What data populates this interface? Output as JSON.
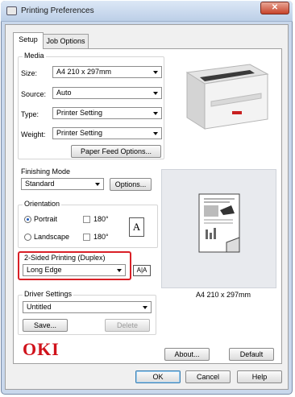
{
  "window": {
    "title": "Printing Preferences",
    "close_glyph": "✕"
  },
  "tabs": [
    {
      "label": "Setup",
      "active": true
    },
    {
      "label": "Job Options",
      "active": false
    }
  ],
  "media": {
    "group_label": "Media",
    "size": {
      "label": "Size:",
      "value": "A4 210 x 297mm"
    },
    "source": {
      "label": "Source:",
      "value": "Auto"
    },
    "type": {
      "label": "Type:",
      "value": "Printer Setting"
    },
    "weight": {
      "label": "Weight:",
      "value": "Printer Setting"
    },
    "paper_feed_button": "Paper Feed Options..."
  },
  "finishing": {
    "group_label": "Finishing Mode",
    "value": "Standard",
    "options_button": "Options..."
  },
  "orientation": {
    "group_label": "Orientation",
    "portrait": "Portrait",
    "landscape": "Landscape",
    "rotate_180": "180°",
    "portrait_selected": true,
    "page_glyph": "A"
  },
  "duplex": {
    "group_label": "2-Sided Printing (Duplex)",
    "value": "Long Edge",
    "icon_glyph": "A|A",
    "highlight_color": "#d92027"
  },
  "preview": {
    "paper_size": "A4 210 x 297mm"
  },
  "driver_settings": {
    "group_label": "Driver Settings",
    "value": "Untitled",
    "save_button": "Save...",
    "delete_button": "Delete"
  },
  "brand": {
    "logo": "OKI",
    "color": "#d0121b"
  },
  "buttons": {
    "about": "About...",
    "default": "Default",
    "ok": "OK",
    "cancel": "Cancel",
    "help": "Help"
  }
}
